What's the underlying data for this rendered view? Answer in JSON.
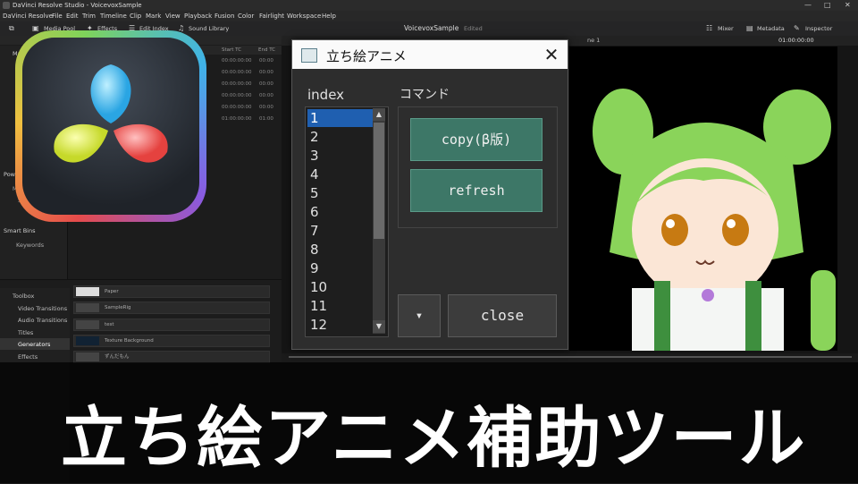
{
  "window": {
    "title": "DaVinci Resolve Studio - VoicevoxSample",
    "controls": [
      "—",
      "□",
      "✕"
    ]
  },
  "menu": [
    "DaVinci Resolve",
    "File",
    "Edit",
    "Trim",
    "Timeline",
    "Clip",
    "Mark",
    "View",
    "Playback",
    "Fusion",
    "Color",
    "Fairlight",
    "Workspace",
    "Help"
  ],
  "toolbar": {
    "media_pool": "Media Pool",
    "effects": "Effects",
    "edit_index": "Edit Index",
    "sound_library": "Sound Library",
    "project_name": "VoicevoxSample",
    "project_status": "Edited",
    "mixer": "Mixer",
    "metadata": "Metadata",
    "inspector": "Inspector",
    "timecode": "01:00:00:00",
    "timeline_name": "ne 1"
  },
  "media_pool": {
    "master": "Mast",
    "columns": [
      "Start TC",
      "End TC"
    ],
    "rows": [
      [
        "00:00:00:00",
        "00:00"
      ],
      [
        "00:00:00:00",
        "00:00"
      ],
      [
        "00:00:00:00",
        "00:00"
      ],
      [
        "00:00:00:00",
        "00:00"
      ],
      [
        "00:00:00:00",
        "00:00"
      ],
      [
        "01:00:00:00",
        "01:00"
      ]
    ],
    "power_bins": "Power",
    "power_master": "Mas",
    "power_item": "SE",
    "smart_bins": "Smart Bins",
    "keywords": "Keywords"
  },
  "toolbox": {
    "nav": [
      "Toolbox",
      "Video Transitions",
      "Audio Transitions",
      "Titles",
      "Generators",
      "Effects"
    ],
    "nav_selected_index": 4,
    "items": [
      "Paper",
      "SampleRig",
      "test",
      "Texture Background",
      "ずんだもん"
    ]
  },
  "dialog": {
    "title": "立ち絵アニメ",
    "close_glyph": "✕",
    "index_label": "index",
    "command_label": "コマンド",
    "list_items": [
      "1",
      "2",
      "3",
      "4",
      "5",
      "6",
      "7",
      "8",
      "9",
      "10",
      "11",
      "12"
    ],
    "selected_item": "1",
    "copy_button": "copy(β版)",
    "refresh_button": "refresh",
    "dropdown_glyph": "▾",
    "close_button": "close",
    "scroll_up": "▲",
    "scroll_down": "▼"
  },
  "banner": {
    "title": "立ち絵アニメ補助ツール"
  },
  "colors": {
    "accent_green": "#3d7767",
    "selection_blue": "#1f5fb0",
    "character_hair": "#8ad45a"
  },
  "icons": [
    "davinci-resolve-logo-icon",
    "media-pool-icon",
    "effects-icon",
    "edit-index-icon",
    "sound-library-icon",
    "mixer-icon",
    "metadata-icon",
    "inspector-icon",
    "dialog-app-icon",
    "close-icon"
  ]
}
